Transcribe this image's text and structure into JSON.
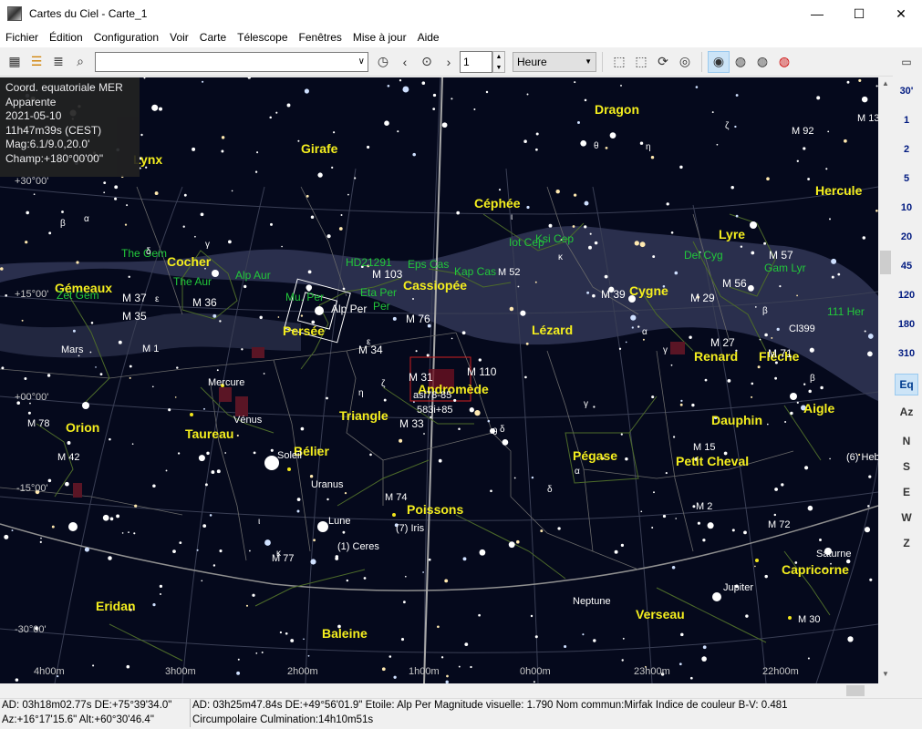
{
  "window": {
    "title": "Cartes du Ciel - Carte_1",
    "minimize": "—",
    "maximize": "☐",
    "close": "✕"
  },
  "menu": [
    "Fichier",
    "Édition",
    "Configuration",
    "Voir",
    "Carte",
    "Télescope",
    "Fenêtres",
    "Mise à jour",
    "Aide"
  ],
  "toolbar": {
    "search_value": "",
    "search_dropdown": "∨",
    "time_step_value": "1",
    "time_unit": "Heure",
    "time_unit_arrow": "▼"
  },
  "infobox": [
    "Coord. equatoriale MER",
    "Apparente",
    "2021-05-10",
    "11h47m39s (CEST)",
    "Mag:6.1/9.0,20.0'",
    "Champ:+180°00'00\""
  ],
  "right_panel": {
    "fov_labels": [
      "30'",
      "1",
      "2",
      "5",
      "10",
      "20",
      "45",
      "120",
      "180",
      "310"
    ],
    "eq_label": "Eq",
    "az_label": "Az",
    "directions": [
      "N",
      "S",
      "E",
      "W",
      "Z"
    ]
  },
  "statusbar": {
    "left_line1": "AD: 03h18m02.77s DE:+75°39'34.0\"",
    "left_line2": "Az:+16°17'15.6\" Alt:+60°30'46.4\"",
    "right_line1": "AD: 03h25m47.84s DE:+49°56'01.9\"  Etoile: Alp Per  Magnitude visuelle:  1.790  Nom commun:Mirfak  Indice de couleur B-V: 0.481",
    "right_line2": "Circumpolaire   Culmination:14h10m51s"
  },
  "sky_map": {
    "constellations": [
      {
        "name": "Dragon"
      },
      {
        "name": "Girafe"
      },
      {
        "name": "Lynx"
      },
      {
        "name": "Céphée"
      },
      {
        "name": "Cocher"
      },
      {
        "name": "Cassiopée"
      },
      {
        "name": "Lyre"
      },
      {
        "name": "Hercule"
      },
      {
        "name": "Gémeaux"
      },
      {
        "name": "Persée"
      },
      {
        "name": "Cygne"
      },
      {
        "name": "Lézard"
      },
      {
        "name": "Renard"
      },
      {
        "name": "Flèche"
      },
      {
        "name": "Andromède"
      },
      {
        "name": "Triangle"
      },
      {
        "name": "Taureau"
      },
      {
        "name": "Orion"
      },
      {
        "name": "Dauphin"
      },
      {
        "name": "Aigle"
      },
      {
        "name": "Bélier"
      },
      {
        "name": "Pégase"
      },
      {
        "name": "Petit Cheval"
      },
      {
        "name": "Poissons"
      },
      {
        "name": "Eridan"
      },
      {
        "name": "Baleine"
      },
      {
        "name": "Verseau"
      },
      {
        "name": "Capricorne"
      }
    ],
    "star_labels": [
      {
        "name": "The Gem"
      },
      {
        "name": "The Aur"
      },
      {
        "name": "Alp Aur"
      },
      {
        "name": "HD21291"
      },
      {
        "name": "Eps Cas"
      },
      {
        "name": "Kap Cas"
      },
      {
        "name": "Iot Cep"
      },
      {
        "name": "Ksi Cep"
      },
      {
        "name": "Del Cyg"
      },
      {
        "name": "Gam Lyr"
      },
      {
        "name": "Mu. Per"
      },
      {
        "name": "Eta Per"
      },
      {
        "name": "Per"
      },
      {
        "name": "111 Her"
      },
      {
        "name": "Zet Gem"
      }
    ],
    "alp_per_label": "Alp Per",
    "objects": [
      {
        "name": "M 103"
      },
      {
        "name": "M 52"
      },
      {
        "name": "M 92"
      },
      {
        "name": "M 13"
      },
      {
        "name": "M 57"
      },
      {
        "name": "M 56"
      },
      {
        "name": "M 29"
      },
      {
        "name": "M 39"
      },
      {
        "name": "M 27"
      },
      {
        "name": "M 71"
      },
      {
        "name": "Cl399"
      },
      {
        "name": "M 76"
      },
      {
        "name": "M 34"
      },
      {
        "name": "M 31"
      },
      {
        "name": "M 110"
      },
      {
        "name": "M 33"
      },
      {
        "name": "M 37"
      },
      {
        "name": "M 36"
      },
      {
        "name": "M 35"
      },
      {
        "name": "M 1"
      },
      {
        "name": "M 78"
      },
      {
        "name": "M 42"
      },
      {
        "name": "M 15"
      },
      {
        "name": "M 74"
      },
      {
        "name": "M 77"
      },
      {
        "name": "M 2"
      },
      {
        "name": "M 72"
      },
      {
        "name": "M 30"
      },
      {
        "name": "Mars"
      },
      {
        "name": "Mercure"
      },
      {
        "name": "Vénus"
      },
      {
        "name": "Soleil"
      },
      {
        "name": "Uranus"
      },
      {
        "name": "Lune"
      },
      {
        "name": "(7) Iris"
      },
      {
        "name": "(1) Ceres"
      },
      {
        "name": "Neptune"
      },
      {
        "name": "Jupiter"
      },
      {
        "name": "Saturne"
      },
      {
        "name": "(6) Heb"
      }
    ],
    "nebula_labels": [
      "asi78-85",
      "583i+85"
    ],
    "dec_labels": [
      "+30°00'",
      "+15°00'",
      "+00°00'",
      "-15°00'",
      "-30°00'"
    ],
    "ra_labels": [
      "4h00m",
      "3h00m",
      "2h00m",
      "1h00m",
      "0h00m",
      "23h00m",
      "22h00m"
    ],
    "greek": [
      {
        "g": "α"
      },
      {
        "g": "β"
      },
      {
        "g": "γ"
      },
      {
        "g": "δ"
      },
      {
        "g": "ε"
      },
      {
        "g": "ζ"
      },
      {
        "g": "η"
      },
      {
        "g": "θ"
      },
      {
        "g": "ι"
      },
      {
        "g": "κ"
      }
    ],
    "colors": {
      "background": "#05091c",
      "milky_way": "#2e3450",
      "constellation_line": "#4d6b2a",
      "constellation_boundary": "#6a6a6a",
      "constellation_label": "#f4ee1e",
      "star_label": "#22c83a",
      "object_label": "#ffffff"
    }
  }
}
